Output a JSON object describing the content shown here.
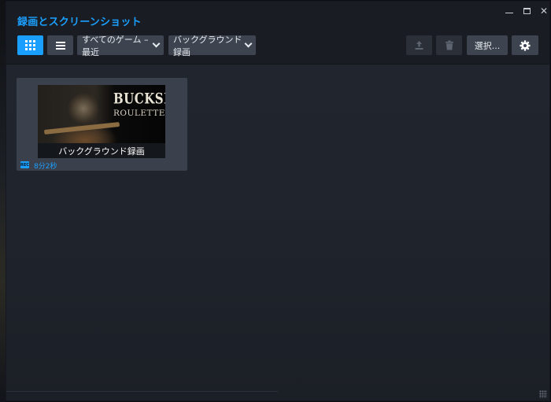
{
  "window": {
    "title": "録画とスクリーンショット",
    "controls": {
      "minimize": "minimize-icon",
      "maximize": "maximize-icon",
      "close": "✕"
    }
  },
  "toolbar": {
    "view_grid_icon": "grid-icon",
    "view_list_icon": "list-icon",
    "game_filter_label": "すべてのゲーム – 最近",
    "type_filter_label": "バックグラウンド録画",
    "upload_icon": "upload-icon",
    "delete_icon": "trash-icon",
    "select_label": "選択...",
    "settings_icon": "gear-icon"
  },
  "recordings": [
    {
      "game_logo_line1": "BUCKSHOT",
      "game_logo_line2": "ROULETTE",
      "caption": "バックグラウンド録画",
      "badge": "REC",
      "duration": "8分2秒"
    }
  ],
  "colors": {
    "accent": "#1a9fff",
    "button": "#3d4450",
    "background": "#1f232b"
  }
}
